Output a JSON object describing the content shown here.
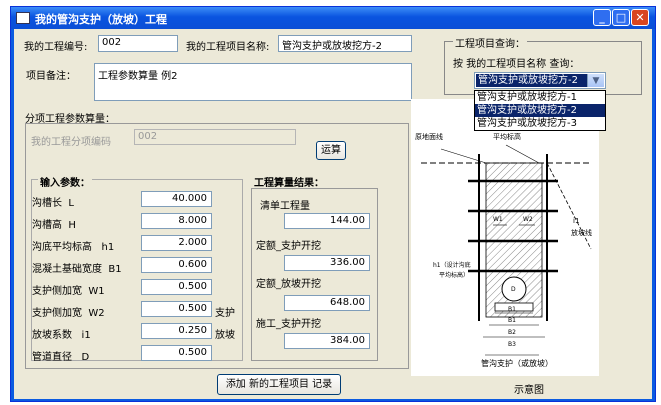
{
  "window": {
    "title": "我的管沟支护（放坡）工程"
  },
  "header": {
    "project_no_label": "我的工程编号:",
    "project_no": "002",
    "project_name_label": "我的工程项目名称:",
    "project_name": "管沟支护或放坡挖方-2",
    "remark_label": "项目备注：",
    "remark": "工程参数算量 例2"
  },
  "query": {
    "group_label": "工程项目查询：",
    "prompt": "按 我的工程项目名称 查询：",
    "selected": "管沟支护或放坡挖方-2",
    "options": [
      "管沟支护或放坡挖方-1",
      "管沟支护或放坡挖方-2",
      "管沟支护或放坡挖方-3"
    ]
  },
  "sub": {
    "section_label": "分项工程参数算量：",
    "code_label": "我的工程分项编码",
    "code": "002",
    "calc_button": "运算"
  },
  "inputs": {
    "title": "输入参数：",
    "rows": [
      {
        "label": "沟槽长",
        "sym": "L",
        "value": "40.000"
      },
      {
        "label": "沟槽高",
        "sym": "H",
        "value": "8.000"
      },
      {
        "label": "沟底平均标高",
        "sym": "h1",
        "value": "2.000"
      },
      {
        "label": "混凝土基础宽度",
        "sym": "B1",
        "value": "0.600"
      },
      {
        "label": "支护侧加宽",
        "sym": "W1",
        "value": "0.500"
      },
      {
        "label": "支护侧加宽",
        "sym": "W2",
        "value": "0.500"
      },
      {
        "label": "放坡系数",
        "sym": "i1",
        "value": "0.250"
      },
      {
        "label": "管道直径",
        "sym": "D",
        "value": "0.500"
      }
    ],
    "side_label_1": "支护",
    "side_label_2": "放坡"
  },
  "results": {
    "title": "工程算量结果：",
    "rows": [
      {
        "label": "清单工程量",
        "value": "144.00"
      },
      {
        "label": "定额_支护开挖",
        "value": "336.00"
      },
      {
        "label": "定额_放坡开挖",
        "value": "648.00"
      },
      {
        "label": "施工_支护开挖",
        "value": "384.00"
      }
    ]
  },
  "diagram": {
    "caption": "示意图",
    "drawing_title": "管沟支护（或放坡）",
    "labels": {
      "left": "原地面线",
      "top": "平均标高",
      "right1": "i1",
      "right2": "放坡线",
      "h1": "h1（设计沟底",
      "h1b": "平均标高）",
      "w1": "W1",
      "w2": "W2",
      "d": "D",
      "b1a": "B1",
      "b1b": "B1",
      "b2": "B2",
      "b3": "B3"
    }
  },
  "footer": {
    "add_button": "添加 新的工程项目 记录"
  }
}
